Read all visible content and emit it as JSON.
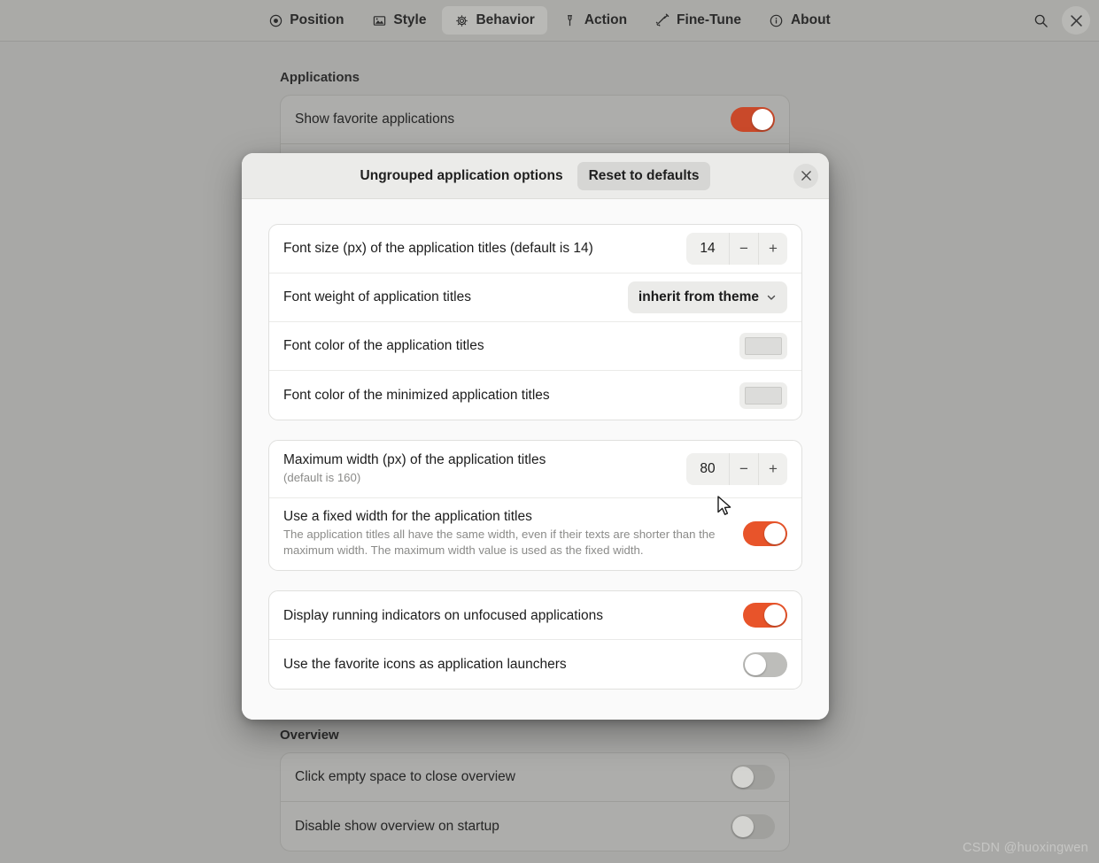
{
  "header": {
    "tabs": [
      {
        "label": "Position",
        "icon": "target-icon",
        "active": false
      },
      {
        "label": "Style",
        "icon": "image-icon",
        "active": false
      },
      {
        "label": "Behavior",
        "icon": "gear-icon",
        "active": true
      },
      {
        "label": "Action",
        "icon": "pin-icon",
        "active": false
      },
      {
        "label": "Fine-Tune",
        "icon": "wrench-icon",
        "active": false
      },
      {
        "label": "About",
        "icon": "info-icon",
        "active": false
      }
    ],
    "search_icon": "search-icon",
    "close_icon": "close-icon"
  },
  "background": {
    "applications": {
      "title": "Applications",
      "rows": [
        {
          "label": "Show favorite applications",
          "toggle": "on"
        }
      ]
    },
    "overview": {
      "title": "Overview",
      "rows": [
        {
          "label": "Click empty space to close overview",
          "toggle": "off"
        },
        {
          "label": "Disable show overview on startup",
          "toggle": "off"
        }
      ]
    }
  },
  "dialog": {
    "title": "Ungrouped application options",
    "reset_label": "Reset to defaults",
    "close_label": "×",
    "group1": {
      "font_size": {
        "label": "Font size (px) of the application titles (default is 14)",
        "value": "14",
        "minus": "−",
        "plus": "+"
      },
      "font_weight": {
        "label": "Font weight of application titles",
        "value": "inherit from theme"
      },
      "font_color": {
        "label": "Font color of the application titles",
        "swatch_color": "#dcdcda"
      },
      "font_color_minimized": {
        "label": "Font color of the minimized application titles",
        "swatch_color": "#dcdcda"
      }
    },
    "group2": {
      "max_width": {
        "label": "Maximum width (px) of the application titles",
        "sub": "(default is 160)",
        "value": "80",
        "minus": "−",
        "plus": "+"
      },
      "fixed_width": {
        "label": "Use a fixed width for the application titles",
        "sub": "The application titles all have the same width, even if their texts are shorter than the maximum width. The maximum width value is used as the fixed width.",
        "toggle": "on"
      }
    },
    "group3": {
      "running_indicators": {
        "label": "Display running indicators on unfocused applications",
        "toggle": "on"
      },
      "favorite_launchers": {
        "label": "Use the favorite icons as application launchers",
        "toggle": "off"
      }
    }
  },
  "watermark": "CSDN @huoxingwen",
  "colors": {
    "accent_orange": "#e8542a",
    "toggle_off": "#bdbdba",
    "desktop_bg": "#a8a8a6"
  }
}
